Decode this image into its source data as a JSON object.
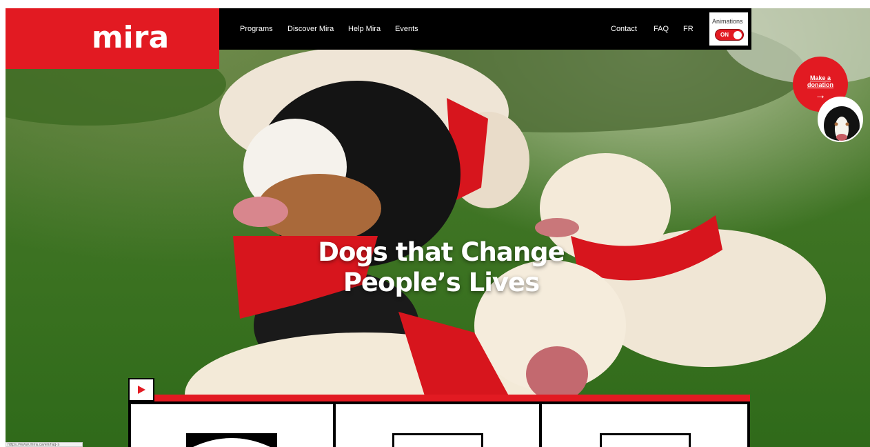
{
  "brand": {
    "logo_text": "mira",
    "accent": "#e21a22"
  },
  "nav": {
    "left": [
      "Programs",
      "Discover Mira",
      "Help Mira",
      "Events"
    ],
    "right": [
      "Contact",
      "FAQ",
      "FR"
    ]
  },
  "animations": {
    "label": "Animations",
    "state": "ON"
  },
  "hero": {
    "headline_line1": "Dogs that Change",
    "headline_line2": "People’s Lives"
  },
  "donate": {
    "label": "Make a donation",
    "arrow": "→"
  },
  "icons": [
    "play-icon",
    "arrow-right-icon"
  ],
  "status_bar": {
    "url": "https://www.mira.ca/en/faq-s"
  }
}
